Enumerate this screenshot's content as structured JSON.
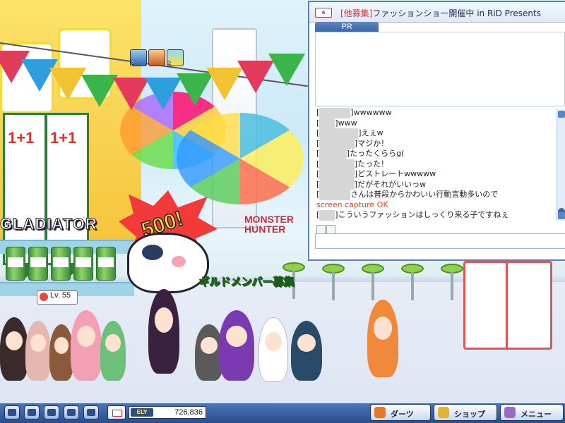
{
  "scene": {
    "gladiator_logo": "GLADIATOR",
    "monster_hunter_logo": "MONSTER HUNTER",
    "burst_text": "500!",
    "guild_recruit": "ギルドメンバー募集",
    "level_tag": "Lv. 55",
    "banner_numeral": "1+1",
    "buffs": [
      {
        "icon": "blue-crystal-buff-icon",
        "count": "2"
      },
      {
        "icon": "orange-pot-buff-icon",
        "count": ""
      },
      {
        "icon": "lightning-buff-icon",
        "count": "2"
      }
    ]
  },
  "chat": {
    "room_icon_text": "6",
    "title_tag": "[他募集]",
    "title_rest": "ファッションショー開催中 in RiD Presents",
    "pr_tab": "PR",
    "lines": [
      {
        "type": "user",
        "prefix": "[",
        "hidden": "ﾐﾐﾐﾐﾐﾐﾐﾐ",
        "text": "]wwwwww"
      },
      {
        "type": "user",
        "prefix": "[",
        "hidden": "ﾐﾐﾐﾐ",
        "text": "]www"
      },
      {
        "type": "user",
        "prefix": "[",
        "hidden": "ﾐﾐﾐﾐﾐﾐﾐﾐﾐﾐ",
        "text": "]えぇw"
      },
      {
        "type": "user",
        "prefix": "[",
        "hidden": "ﾐﾐﾐﾐﾐﾐﾐﾐﾐ",
        "text": "]マジか！"
      },
      {
        "type": "user",
        "prefix": "[",
        "hidden": "ﾐﾐﾐﾐﾐﾐﾐ",
        "text": "]たったくららg("
      },
      {
        "type": "user",
        "prefix": "[",
        "hidden": "ﾐﾐﾐﾐﾐﾐﾐﾐﾐ",
        "text": "]たった！"
      },
      {
        "type": "user",
        "prefix": "[",
        "hidden": "ﾐﾐﾐﾐﾐﾐﾐﾐﾐ",
        "text": "]どストレートwwwww"
      },
      {
        "type": "user",
        "prefix": "[",
        "hidden": "ﾐﾐﾐﾐﾐﾐﾐﾐﾐ",
        "text": "]だがそれがいいっw"
      },
      {
        "type": "user",
        "prefix": "[",
        "hidden": "ﾐﾐﾐﾐﾐﾐﾐﾐ",
        "text": "さんは普段からかわいい行動言動多いので"
      },
      {
        "type": "system",
        "prefix": "",
        "hidden": "",
        "text": "screen capture OK"
      },
      {
        "type": "user",
        "prefix": "[",
        "hidden": "ﾐﾐﾐﾐ",
        "text": "]こういうファッションはしっくり来る子ですねぇ"
      }
    ]
  },
  "taskbar": {
    "ely_label": "ELY",
    "ely_value": "726,836",
    "buttons": [
      {
        "label": "ダーツ",
        "icon": "darts-icon",
        "color": "#e07a2a"
      },
      {
        "label": "ショップ",
        "icon": "shop-icon",
        "color": "#e2b23a"
      },
      {
        "label": "メニュー",
        "icon": "gear-menu-icon",
        "color": "#9a6ac8"
      }
    ]
  },
  "colors": {
    "accent_blue": "#3d66a8",
    "system_text": "#e2411e",
    "title_tag_red": "#d33"
  }
}
